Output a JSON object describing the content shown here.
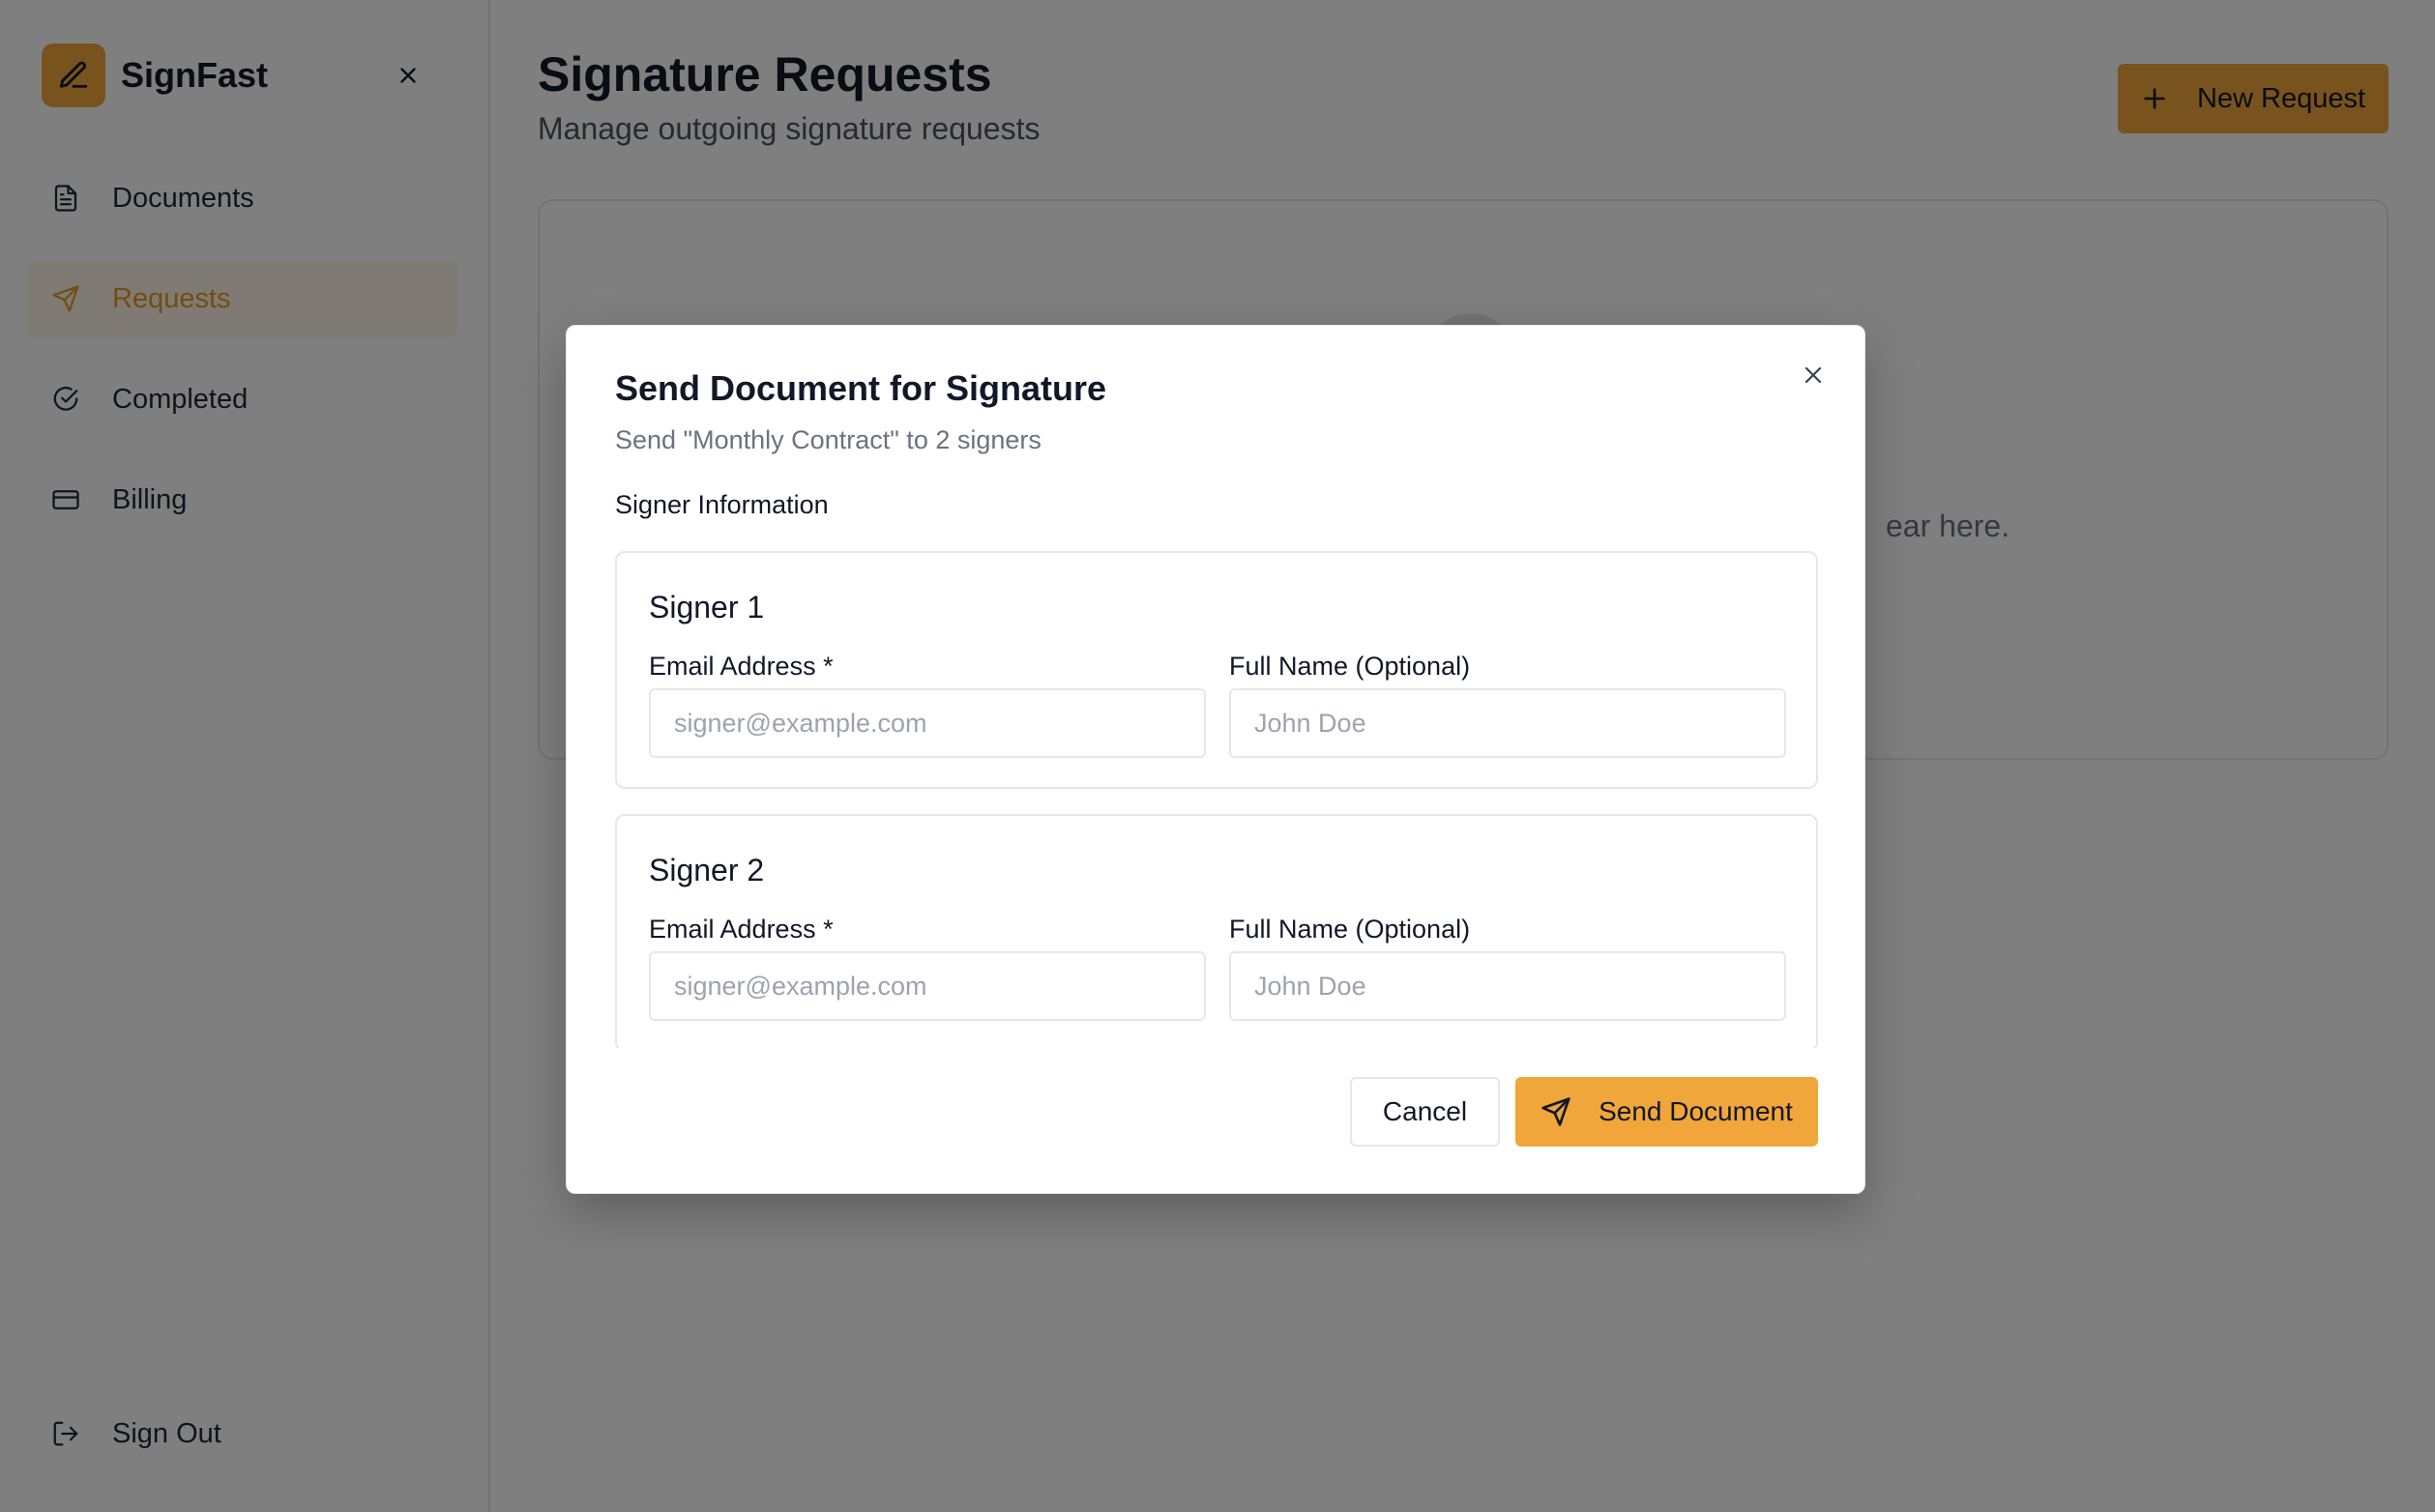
{
  "app": {
    "brand": "SignFast",
    "accent_color": "#f0a63a"
  },
  "sidebar": {
    "items": [
      {
        "label": "Documents",
        "icon": "document-icon",
        "active": false
      },
      {
        "label": "Requests",
        "icon": "send-icon",
        "active": true
      },
      {
        "label": "Completed",
        "icon": "check-circle-icon",
        "active": false
      },
      {
        "label": "Billing",
        "icon": "credit-card-icon",
        "active": false
      }
    ],
    "signout_label": "Sign Out"
  },
  "main": {
    "title": "Signature Requests",
    "subtitle": "Manage outgoing signature requests",
    "new_request_label": "New Request",
    "empty_text_partial": "ear here."
  },
  "modal": {
    "title": "Send Document for Signature",
    "description": "Send \"Monthly Contract\" to 2 signers",
    "section_label": "Signer Information",
    "signers": [
      {
        "title": "Signer 1",
        "email_label": "Email Address *",
        "email_placeholder": "signer@example.com",
        "name_label": "Full Name (Optional)",
        "name_placeholder": "John Doe"
      },
      {
        "title": "Signer 2",
        "email_label": "Email Address *",
        "email_placeholder": "signer@example.com",
        "name_label": "Full Name (Optional)",
        "name_placeholder": "John Doe"
      }
    ],
    "cancel_label": "Cancel",
    "send_label": "Send Document"
  }
}
